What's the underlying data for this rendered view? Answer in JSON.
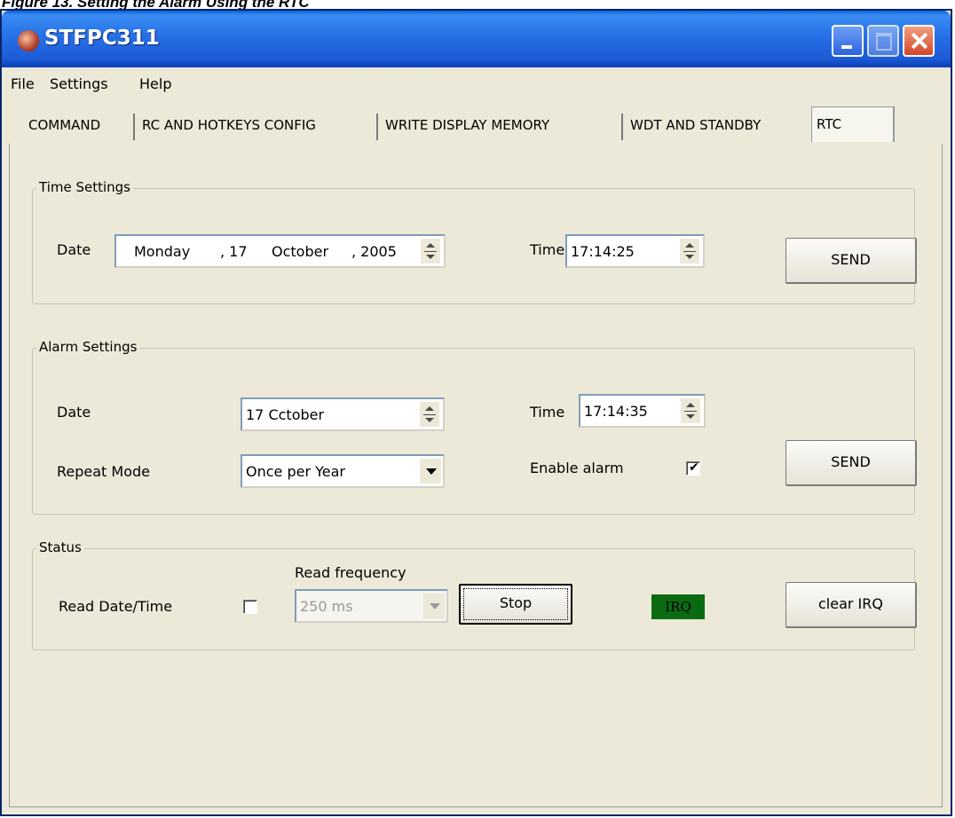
{
  "figure_caption": "Figure 13.   Setting the Alarm Using the RTC",
  "window": {
    "title": "STFPC311",
    "controls": [
      "minimize-icon",
      "maximize-icon",
      "close-icon"
    ]
  },
  "menu": [
    "File",
    "Settings",
    "Help"
  ],
  "tabs": [
    {
      "label": "COMMAND",
      "active": false
    },
    {
      "label": "RC AND HOTKEYS CONFIG",
      "active": false
    },
    {
      "label": "WRITE DISPLAY MEMORY",
      "active": false
    },
    {
      "label": "WDT AND STANDBY",
      "active": false
    },
    {
      "label": "RTC",
      "active": true
    }
  ],
  "time_settings": {
    "group_label": "Time Settings",
    "date_label": "Date",
    "date_value": {
      "weekday": "Monday",
      "day": ", 17",
      "month": "October",
      "year": ", 2005"
    },
    "time_label": "Time",
    "time_value": "17:14:25",
    "send_label": "SEND"
  },
  "alarm_settings": {
    "group_label": "Alarm Settings",
    "date_label": "Date",
    "date_value": "17  Cctober",
    "time_label": "Time",
    "time_value": "17:14:35",
    "repeat_label": "Repeat Mode",
    "repeat_value": "Once per Year",
    "enable_label": "Enable alarm",
    "enable_checked": true,
    "send_label": "SEND"
  },
  "status": {
    "group_label": "Status",
    "read_datetime_label": "Read Date/Time",
    "read_datetime_checked": false,
    "read_frequency_label": "Read frequency",
    "read_frequency_value": "250 ms",
    "stop_label": "Stop",
    "irq_label": "IRQ",
    "irq_color": "#0b6b12",
    "clear_irq_label": "clear IRQ"
  },
  "colors": {
    "titlebar": "#2770e6",
    "window_bg": "#ece9d8"
  }
}
